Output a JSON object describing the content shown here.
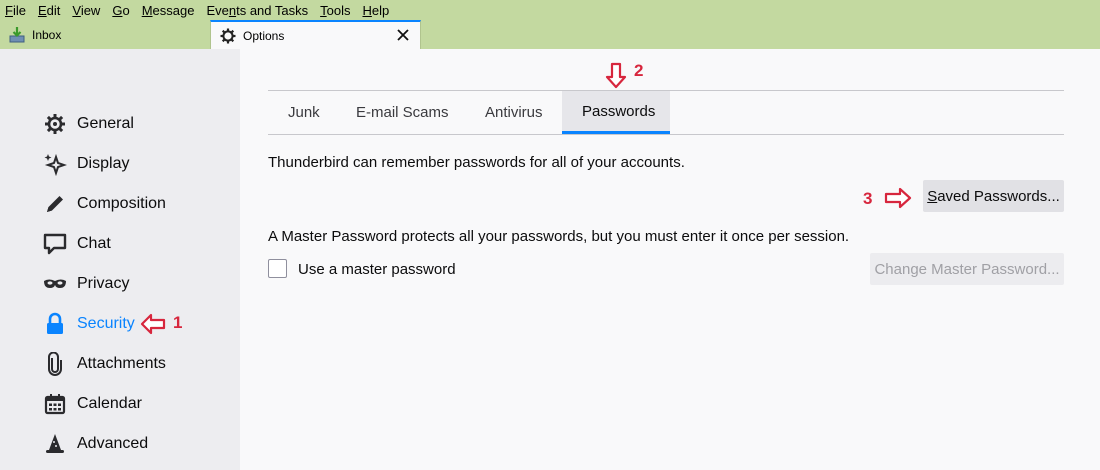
{
  "menu": [
    "File",
    "Edit",
    "View",
    "Go",
    "Message",
    "Events and Tasks",
    "Tools",
    "Help"
  ],
  "menu_accel": [
    "F",
    "E",
    "V",
    "G",
    "M",
    "n",
    "T",
    "H"
  ],
  "tabs": {
    "inbox": {
      "label": "Inbox",
      "icon": "inbox-download-icon"
    },
    "options": {
      "label": "Options",
      "icon": "gear-icon"
    }
  },
  "sidebar": {
    "items": [
      {
        "label": "General",
        "icon": "gear-icon"
      },
      {
        "label": "Display",
        "icon": "sparkle-icon"
      },
      {
        "label": "Composition",
        "icon": "pencil-icon"
      },
      {
        "label": "Chat",
        "icon": "chat-bubble-icon"
      },
      {
        "label": "Privacy",
        "icon": "mask-icon"
      },
      {
        "label": "Security",
        "icon": "lock-icon",
        "selected": true
      },
      {
        "label": "Attachments",
        "icon": "paperclip-icon"
      },
      {
        "label": "Calendar",
        "icon": "calendar-icon"
      },
      {
        "label": "Advanced",
        "icon": "wizard-hat-icon"
      }
    ]
  },
  "security": {
    "tabs": [
      "Junk",
      "E-mail Scams",
      "Antivirus",
      "Passwords"
    ],
    "active_tab": "Passwords",
    "passwords_text": "Thunderbird can remember passwords for all of your accounts.",
    "saved_passwords_button": "Saved Passwords...",
    "master_text": "A Master Password protects all your passwords, but you must enter it once per session.",
    "master_checkbox_label": "Use a master password",
    "master_checkbox_checked": false,
    "change_master_button": "Change Master Password..."
  },
  "annotations": {
    "step1": "1",
    "step2": "2",
    "step3": "3"
  },
  "colors": {
    "accent": "#0a84ff",
    "annotation": "#d7263d",
    "chrome": "#c3d9a0"
  }
}
